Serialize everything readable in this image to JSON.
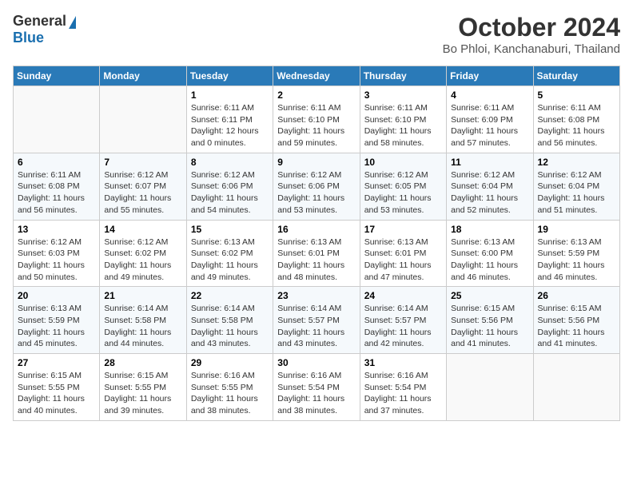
{
  "logo": {
    "general": "General",
    "blue": "Blue"
  },
  "header": {
    "month": "October 2024",
    "location": "Bo Phloi, Kanchanaburi, Thailand"
  },
  "weekdays": [
    "Sunday",
    "Monday",
    "Tuesday",
    "Wednesday",
    "Thursday",
    "Friday",
    "Saturday"
  ],
  "weeks": [
    [
      {
        "day": null
      },
      {
        "day": null
      },
      {
        "day": 1,
        "sunrise": "6:11 AM",
        "sunset": "6:11 PM",
        "daylight": "12 hours and 0 minutes."
      },
      {
        "day": 2,
        "sunrise": "6:11 AM",
        "sunset": "6:10 PM",
        "daylight": "11 hours and 59 minutes."
      },
      {
        "day": 3,
        "sunrise": "6:11 AM",
        "sunset": "6:10 PM",
        "daylight": "11 hours and 58 minutes."
      },
      {
        "day": 4,
        "sunrise": "6:11 AM",
        "sunset": "6:09 PM",
        "daylight": "11 hours and 57 minutes."
      },
      {
        "day": 5,
        "sunrise": "6:11 AM",
        "sunset": "6:08 PM",
        "daylight": "11 hours and 56 minutes."
      }
    ],
    [
      {
        "day": 6,
        "sunrise": "6:11 AM",
        "sunset": "6:08 PM",
        "daylight": "11 hours and 56 minutes."
      },
      {
        "day": 7,
        "sunrise": "6:12 AM",
        "sunset": "6:07 PM",
        "daylight": "11 hours and 55 minutes."
      },
      {
        "day": 8,
        "sunrise": "6:12 AM",
        "sunset": "6:06 PM",
        "daylight": "11 hours and 54 minutes."
      },
      {
        "day": 9,
        "sunrise": "6:12 AM",
        "sunset": "6:06 PM",
        "daylight": "11 hours and 53 minutes."
      },
      {
        "day": 10,
        "sunrise": "6:12 AM",
        "sunset": "6:05 PM",
        "daylight": "11 hours and 53 minutes."
      },
      {
        "day": 11,
        "sunrise": "6:12 AM",
        "sunset": "6:04 PM",
        "daylight": "11 hours and 52 minutes."
      },
      {
        "day": 12,
        "sunrise": "6:12 AM",
        "sunset": "6:04 PM",
        "daylight": "11 hours and 51 minutes."
      }
    ],
    [
      {
        "day": 13,
        "sunrise": "6:12 AM",
        "sunset": "6:03 PM",
        "daylight": "11 hours and 50 minutes."
      },
      {
        "day": 14,
        "sunrise": "6:12 AM",
        "sunset": "6:02 PM",
        "daylight": "11 hours and 49 minutes."
      },
      {
        "day": 15,
        "sunrise": "6:13 AM",
        "sunset": "6:02 PM",
        "daylight": "11 hours and 49 minutes."
      },
      {
        "day": 16,
        "sunrise": "6:13 AM",
        "sunset": "6:01 PM",
        "daylight": "11 hours and 48 minutes."
      },
      {
        "day": 17,
        "sunrise": "6:13 AM",
        "sunset": "6:01 PM",
        "daylight": "11 hours and 47 minutes."
      },
      {
        "day": 18,
        "sunrise": "6:13 AM",
        "sunset": "6:00 PM",
        "daylight": "11 hours and 46 minutes."
      },
      {
        "day": 19,
        "sunrise": "6:13 AM",
        "sunset": "5:59 PM",
        "daylight": "11 hours and 46 minutes."
      }
    ],
    [
      {
        "day": 20,
        "sunrise": "6:13 AM",
        "sunset": "5:59 PM",
        "daylight": "11 hours and 45 minutes."
      },
      {
        "day": 21,
        "sunrise": "6:14 AM",
        "sunset": "5:58 PM",
        "daylight": "11 hours and 44 minutes."
      },
      {
        "day": 22,
        "sunrise": "6:14 AM",
        "sunset": "5:58 PM",
        "daylight": "11 hours and 43 minutes."
      },
      {
        "day": 23,
        "sunrise": "6:14 AM",
        "sunset": "5:57 PM",
        "daylight": "11 hours and 43 minutes."
      },
      {
        "day": 24,
        "sunrise": "6:14 AM",
        "sunset": "5:57 PM",
        "daylight": "11 hours and 42 minutes."
      },
      {
        "day": 25,
        "sunrise": "6:15 AM",
        "sunset": "5:56 PM",
        "daylight": "11 hours and 41 minutes."
      },
      {
        "day": 26,
        "sunrise": "6:15 AM",
        "sunset": "5:56 PM",
        "daylight": "11 hours and 41 minutes."
      }
    ],
    [
      {
        "day": 27,
        "sunrise": "6:15 AM",
        "sunset": "5:55 PM",
        "daylight": "11 hours and 40 minutes."
      },
      {
        "day": 28,
        "sunrise": "6:15 AM",
        "sunset": "5:55 PM",
        "daylight": "11 hours and 39 minutes."
      },
      {
        "day": 29,
        "sunrise": "6:16 AM",
        "sunset": "5:55 PM",
        "daylight": "11 hours and 38 minutes."
      },
      {
        "day": 30,
        "sunrise": "6:16 AM",
        "sunset": "5:54 PM",
        "daylight": "11 hours and 38 minutes."
      },
      {
        "day": 31,
        "sunrise": "6:16 AM",
        "sunset": "5:54 PM",
        "daylight": "11 hours and 37 minutes."
      },
      {
        "day": null
      },
      {
        "day": null
      }
    ]
  ]
}
